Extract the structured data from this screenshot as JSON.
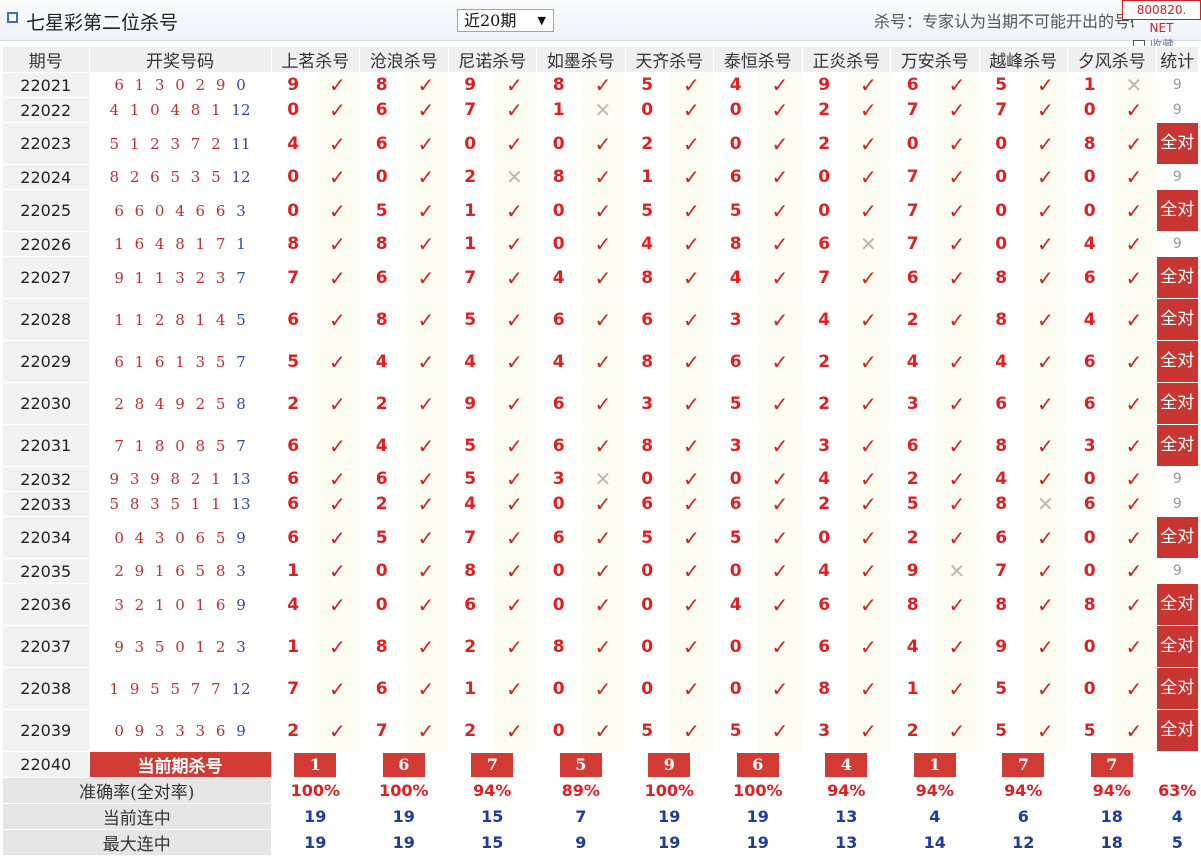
{
  "header": {
    "title": "七星彩第二位杀号",
    "period_select": "近20期",
    "select_arrow": "▼",
    "note": "杀号：专家认为当期不可能开出的号码",
    "watermark": "800820. NET",
    "corner_text": "收藏"
  },
  "columns": {
    "issue": "期号",
    "winning": "开奖号码",
    "experts": [
      "上茗杀号",
      "沧浪杀号",
      "尼诺杀号",
      "如墨杀号",
      "天齐杀号",
      "泰恒杀号",
      "正炎杀号",
      "万安杀号",
      "越峰杀号",
      "夕风杀号"
    ],
    "stat": "统计"
  },
  "rows": [
    {
      "issue": "22021",
      "digits": "6 1 3 0 2 9",
      "extra": "0",
      "kills": [
        [
          "9",
          1
        ],
        [
          "8",
          1
        ],
        [
          "9",
          1
        ],
        [
          "8",
          1
        ],
        [
          "5",
          1
        ],
        [
          "4",
          1
        ],
        [
          "9",
          1
        ],
        [
          "6",
          1
        ],
        [
          "5",
          1
        ],
        [
          "1",
          0
        ]
      ],
      "stat": "9",
      "full": false
    },
    {
      "issue": "22022",
      "digits": "4 1 0 4 8 1",
      "extra": "12",
      "kills": [
        [
          "0",
          1
        ],
        [
          "6",
          1
        ],
        [
          "7",
          1
        ],
        [
          "1",
          0
        ],
        [
          "0",
          1
        ],
        [
          "0",
          1
        ],
        [
          "2",
          1
        ],
        [
          "7",
          1
        ],
        [
          "7",
          1
        ],
        [
          "0",
          1
        ]
      ],
      "stat": "9",
      "full": false
    },
    {
      "issue": "22023",
      "digits": "5 1 2 3 7 2",
      "extra": "11",
      "kills": [
        [
          "4",
          1
        ],
        [
          "6",
          1
        ],
        [
          "0",
          1
        ],
        [
          "0",
          1
        ],
        [
          "2",
          1
        ],
        [
          "0",
          1
        ],
        [
          "2",
          1
        ],
        [
          "0",
          1
        ],
        [
          "0",
          1
        ],
        [
          "8",
          1
        ]
      ],
      "stat": "全对",
      "full": true
    },
    {
      "issue": "22024",
      "digits": "8 2 6 5 3 5",
      "extra": "12",
      "kills": [
        [
          "0",
          1
        ],
        [
          "0",
          1
        ],
        [
          "2",
          0
        ],
        [
          "8",
          1
        ],
        [
          "1",
          1
        ],
        [
          "6",
          1
        ],
        [
          "0",
          1
        ],
        [
          "7",
          1
        ],
        [
          "0",
          1
        ],
        [
          "0",
          1
        ]
      ],
      "stat": "9",
      "full": false
    },
    {
      "issue": "22025",
      "digits": "6 6 0 4 6 6",
      "extra": "3",
      "kills": [
        [
          "0",
          1
        ],
        [
          "5",
          1
        ],
        [
          "1",
          1
        ],
        [
          "0",
          1
        ],
        [
          "5",
          1
        ],
        [
          "5",
          1
        ],
        [
          "0",
          1
        ],
        [
          "7",
          1
        ],
        [
          "0",
          1
        ],
        [
          "0",
          1
        ]
      ],
      "stat": "全对",
      "full": true
    },
    {
      "issue": "22026",
      "digits": "1 6 4 8 1 7",
      "extra": "1",
      "kills": [
        [
          "8",
          1
        ],
        [
          "8",
          1
        ],
        [
          "1",
          1
        ],
        [
          "0",
          1
        ],
        [
          "4",
          1
        ],
        [
          "8",
          1
        ],
        [
          "6",
          0
        ],
        [
          "7",
          1
        ],
        [
          "0",
          1
        ],
        [
          "4",
          1
        ]
      ],
      "stat": "9",
      "full": false
    },
    {
      "issue": "22027",
      "digits": "9 1 1 3 2 3",
      "extra": "7",
      "kills": [
        [
          "7",
          1
        ],
        [
          "6",
          1
        ],
        [
          "7",
          1
        ],
        [
          "4",
          1
        ],
        [
          "8",
          1
        ],
        [
          "4",
          1
        ],
        [
          "7",
          1
        ],
        [
          "6",
          1
        ],
        [
          "8",
          1
        ],
        [
          "6",
          1
        ]
      ],
      "stat": "全对",
      "full": true
    },
    {
      "issue": "22028",
      "digits": "1 1 2 8 1 4",
      "extra": "5",
      "kills": [
        [
          "6",
          1
        ],
        [
          "8",
          1
        ],
        [
          "5",
          1
        ],
        [
          "6",
          1
        ],
        [
          "6",
          1
        ],
        [
          "3",
          1
        ],
        [
          "4",
          1
        ],
        [
          "2",
          1
        ],
        [
          "8",
          1
        ],
        [
          "4",
          1
        ]
      ],
      "stat": "全对",
      "full": true
    },
    {
      "issue": "22029",
      "digits": "6 1 6 1 3 5",
      "extra": "7",
      "kills": [
        [
          "5",
          1
        ],
        [
          "4",
          1
        ],
        [
          "4",
          1
        ],
        [
          "4",
          1
        ],
        [
          "8",
          1
        ],
        [
          "6",
          1
        ],
        [
          "2",
          1
        ],
        [
          "4",
          1
        ],
        [
          "4",
          1
        ],
        [
          "6",
          1
        ]
      ],
      "stat": "全对",
      "full": true
    },
    {
      "issue": "22030",
      "digits": "2 8 4 9 2 5",
      "extra": "8",
      "kills": [
        [
          "2",
          1
        ],
        [
          "2",
          1
        ],
        [
          "9",
          1
        ],
        [
          "6",
          1
        ],
        [
          "3",
          1
        ],
        [
          "5",
          1
        ],
        [
          "2",
          1
        ],
        [
          "3",
          1
        ],
        [
          "6",
          1
        ],
        [
          "6",
          1
        ]
      ],
      "stat": "全对",
      "full": true
    },
    {
      "issue": "22031",
      "digits": "7 1 8 0 8 5",
      "extra": "7",
      "kills": [
        [
          "6",
          1
        ],
        [
          "4",
          1
        ],
        [
          "5",
          1
        ],
        [
          "6",
          1
        ],
        [
          "8",
          1
        ],
        [
          "3",
          1
        ],
        [
          "3",
          1
        ],
        [
          "6",
          1
        ],
        [
          "8",
          1
        ],
        [
          "3",
          1
        ]
      ],
      "stat": "全对",
      "full": true
    },
    {
      "issue": "22032",
      "digits": "9 3 9 8 2 1",
      "extra": "13",
      "kills": [
        [
          "6",
          1
        ],
        [
          "6",
          1
        ],
        [
          "5",
          1
        ],
        [
          "3",
          0
        ],
        [
          "0",
          1
        ],
        [
          "0",
          1
        ],
        [
          "4",
          1
        ],
        [
          "2",
          1
        ],
        [
          "4",
          1
        ],
        [
          "0",
          1
        ]
      ],
      "stat": "9",
      "full": false
    },
    {
      "issue": "22033",
      "digits": "5 8 3 5 1 1",
      "extra": "13",
      "kills": [
        [
          "6",
          1
        ],
        [
          "2",
          1
        ],
        [
          "4",
          1
        ],
        [
          "0",
          1
        ],
        [
          "6",
          1
        ],
        [
          "6",
          1
        ],
        [
          "2",
          1
        ],
        [
          "5",
          1
        ],
        [
          "8",
          0
        ],
        [
          "6",
          1
        ]
      ],
      "stat": "9",
      "full": false
    },
    {
      "issue": "22034",
      "digits": "0 4 3 0 6 5",
      "extra": "9",
      "kills": [
        [
          "6",
          1
        ],
        [
          "5",
          1
        ],
        [
          "7",
          1
        ],
        [
          "6",
          1
        ],
        [
          "5",
          1
        ],
        [
          "5",
          1
        ],
        [
          "0",
          1
        ],
        [
          "2",
          1
        ],
        [
          "6",
          1
        ],
        [
          "0",
          1
        ]
      ],
      "stat": "全对",
      "full": true
    },
    {
      "issue": "22035",
      "digits": "2 9 1 6 5 8",
      "extra": "3",
      "kills": [
        [
          "1",
          1
        ],
        [
          "0",
          1
        ],
        [
          "8",
          1
        ],
        [
          "0",
          1
        ],
        [
          "0",
          1
        ],
        [
          "0",
          1
        ],
        [
          "4",
          1
        ],
        [
          "9",
          0
        ],
        [
          "7",
          1
        ],
        [
          "0",
          1
        ]
      ],
      "stat": "9",
      "full": false
    },
    {
      "issue": "22036",
      "digits": "3 2 1 0 1 6",
      "extra": "9",
      "kills": [
        [
          "4",
          1
        ],
        [
          "0",
          1
        ],
        [
          "6",
          1
        ],
        [
          "0",
          1
        ],
        [
          "0",
          1
        ],
        [
          "4",
          1
        ],
        [
          "6",
          1
        ],
        [
          "8",
          1
        ],
        [
          "8",
          1
        ],
        [
          "8",
          1
        ]
      ],
      "stat": "全对",
      "full": true
    },
    {
      "issue": "22037",
      "digits": "9 3 5 0 1 2",
      "extra": "3",
      "kills": [
        [
          "1",
          1
        ],
        [
          "8",
          1
        ],
        [
          "2",
          1
        ],
        [
          "8",
          1
        ],
        [
          "0",
          1
        ],
        [
          "0",
          1
        ],
        [
          "6",
          1
        ],
        [
          "4",
          1
        ],
        [
          "9",
          1
        ],
        [
          "0",
          1
        ]
      ],
      "stat": "全对",
      "full": true
    },
    {
      "issue": "22038",
      "digits": "1 9 5 5 7 7",
      "extra": "12",
      "kills": [
        [
          "7",
          1
        ],
        [
          "6",
          1
        ],
        [
          "1",
          1
        ],
        [
          "0",
          1
        ],
        [
          "0",
          1
        ],
        [
          "0",
          1
        ],
        [
          "8",
          1
        ],
        [
          "1",
          1
        ],
        [
          "5",
          1
        ],
        [
          "0",
          1
        ]
      ],
      "stat": "全对",
      "full": true
    },
    {
      "issue": "22039",
      "digits": "0 9 3 3 3 6",
      "extra": "9",
      "kills": [
        [
          "2",
          1
        ],
        [
          "7",
          1
        ],
        [
          "2",
          1
        ],
        [
          "0",
          1
        ],
        [
          "5",
          1
        ],
        [
          "5",
          1
        ],
        [
          "3",
          1
        ],
        [
          "2",
          1
        ],
        [
          "5",
          1
        ],
        [
          "5",
          1
        ]
      ],
      "stat": "全对",
      "full": true
    }
  ],
  "current": {
    "issue": "22040",
    "label": "当前期杀号",
    "kills": [
      "1",
      "6",
      "7",
      "5",
      "9",
      "6",
      "4",
      "1",
      "7",
      "7"
    ]
  },
  "summary": {
    "accuracy_label": "准确率(全对率)",
    "accuracy": [
      "100%",
      "100%",
      "94%",
      "89%",
      "100%",
      "100%",
      "94%",
      "94%",
      "94%",
      "94%"
    ],
    "accuracy_total": "63%",
    "current_streak_label": "当前连中",
    "current_streak": [
      "19",
      "19",
      "15",
      "7",
      "19",
      "19",
      "13",
      "4",
      "6",
      "18"
    ],
    "current_streak_total": "4",
    "max_streak_label": "最大连中",
    "max_streak": [
      "19",
      "19",
      "15",
      "9",
      "19",
      "19",
      "13",
      "14",
      "12",
      "18"
    ],
    "max_streak_total": "5"
  },
  "marks": {
    "hit": "✓",
    "miss": "✕"
  }
}
